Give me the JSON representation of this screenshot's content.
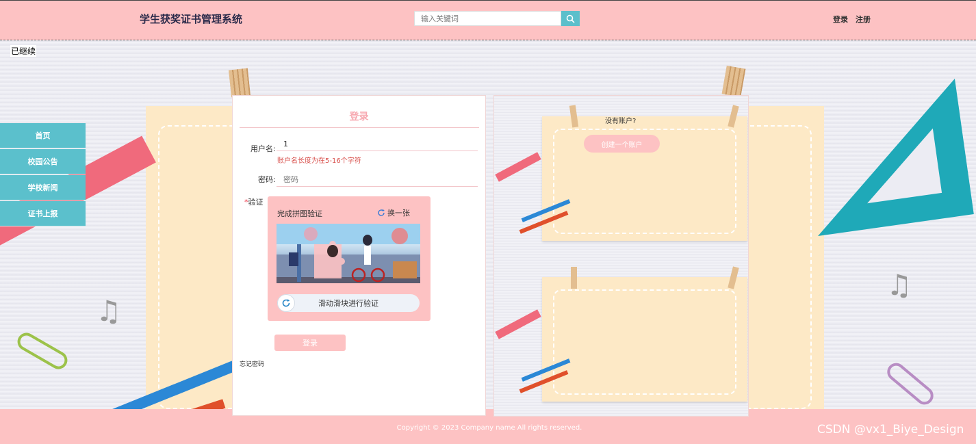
{
  "header": {
    "site_title": "学生获奖证书管理系统",
    "search_placeholder": "输入关键词",
    "login_link": "登录",
    "register_link": "注册"
  },
  "overlay": {
    "continued": "已继续"
  },
  "sidebar": {
    "items": [
      {
        "label": "首页"
      },
      {
        "label": "校园公告"
      },
      {
        "label": "学校新闻"
      },
      {
        "label": "证书上报"
      }
    ]
  },
  "login": {
    "title": "登录",
    "username_label": "用户名:",
    "username_value": "1",
    "username_error": "账户名长度为在5-16个字符",
    "password_label": "密码:",
    "password_placeholder": "密码",
    "captcha_required": "*",
    "captcha_label": "验证",
    "captcha_title": "完成拼图验证",
    "captcha_refresh": "换一张",
    "slider_text": "滑动滑块进行验证",
    "submit": "登录",
    "forgot": "忘记密码"
  },
  "register": {
    "question": "没有账户?",
    "create_button": "创建一个账户"
  },
  "footer": {
    "copyright": "Copyright © 2023 Company name All rights reserved.",
    "watermark": "CSDN @vx1_Biye_Design"
  },
  "colors": {
    "header_bg": "#fdc2c3",
    "sidebar_bg": "#5bc0cc",
    "accent_pink": "#f7a8b0",
    "error_red": "#d9534f",
    "paper": "#fde9c6"
  },
  "icons": {
    "search": "search-icon",
    "refresh": "refresh-icon",
    "slider": "refresh-slider-icon"
  }
}
